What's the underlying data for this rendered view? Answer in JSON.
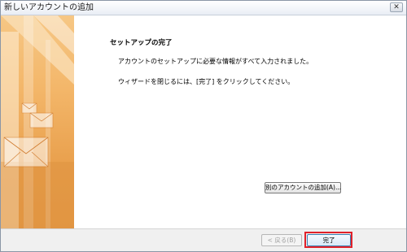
{
  "window": {
    "title": "新しいアカウントの追加",
    "close_symbol": "✕"
  },
  "content": {
    "heading": "セットアップの完了",
    "message_1": "アカウントのセットアップに必要な情報がすべて入力されました。",
    "message_2": "ウィザードを閉じるには、[完了] をクリックしてください。",
    "add_account_label": "別のアカウントの追加(A)..."
  },
  "footer": {
    "back_label": "< 戻る(B)",
    "finish_label": "完了"
  },
  "colors": {
    "highlight": "#e0212a",
    "panel_orange": "#f3b669"
  },
  "icons": [
    "close-icon",
    "envelope-icon"
  ]
}
